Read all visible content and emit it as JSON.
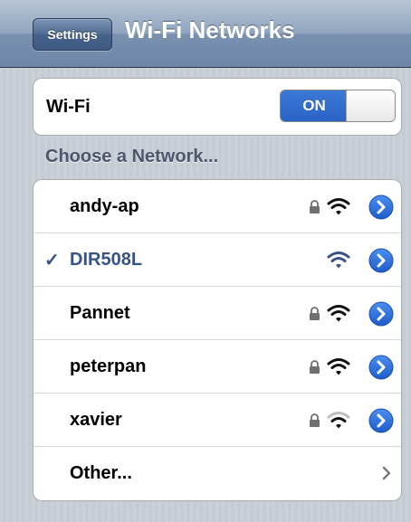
{
  "navbar": {
    "back_label": "Settings",
    "title": "Wi-Fi Networks"
  },
  "wifi": {
    "label": "Wi-Fi",
    "toggle_label": "ON",
    "enabled": true
  },
  "section": {
    "header": "Choose a Network..."
  },
  "networks": [
    {
      "name": "andy-ap",
      "secured": true,
      "signal": "full",
      "selected": false,
      "icon": "lock-icon"
    },
    {
      "name": "DIR508L",
      "secured": false,
      "signal": "full",
      "selected": true,
      "check": "✓"
    },
    {
      "name": "Pannet",
      "secured": true,
      "signal": "full",
      "selected": false
    },
    {
      "name": "peterpan",
      "secured": true,
      "signal": "full",
      "selected": false
    },
    {
      "name": "xavier",
      "secured": true,
      "signal": "weak",
      "selected": false
    }
  ],
  "other": {
    "label": "Other..."
  },
  "colors": {
    "navbar": "#7a91b0",
    "accent_blue": "#2b63c5",
    "selected_text": "#385487",
    "background": "#c5ccd4"
  }
}
